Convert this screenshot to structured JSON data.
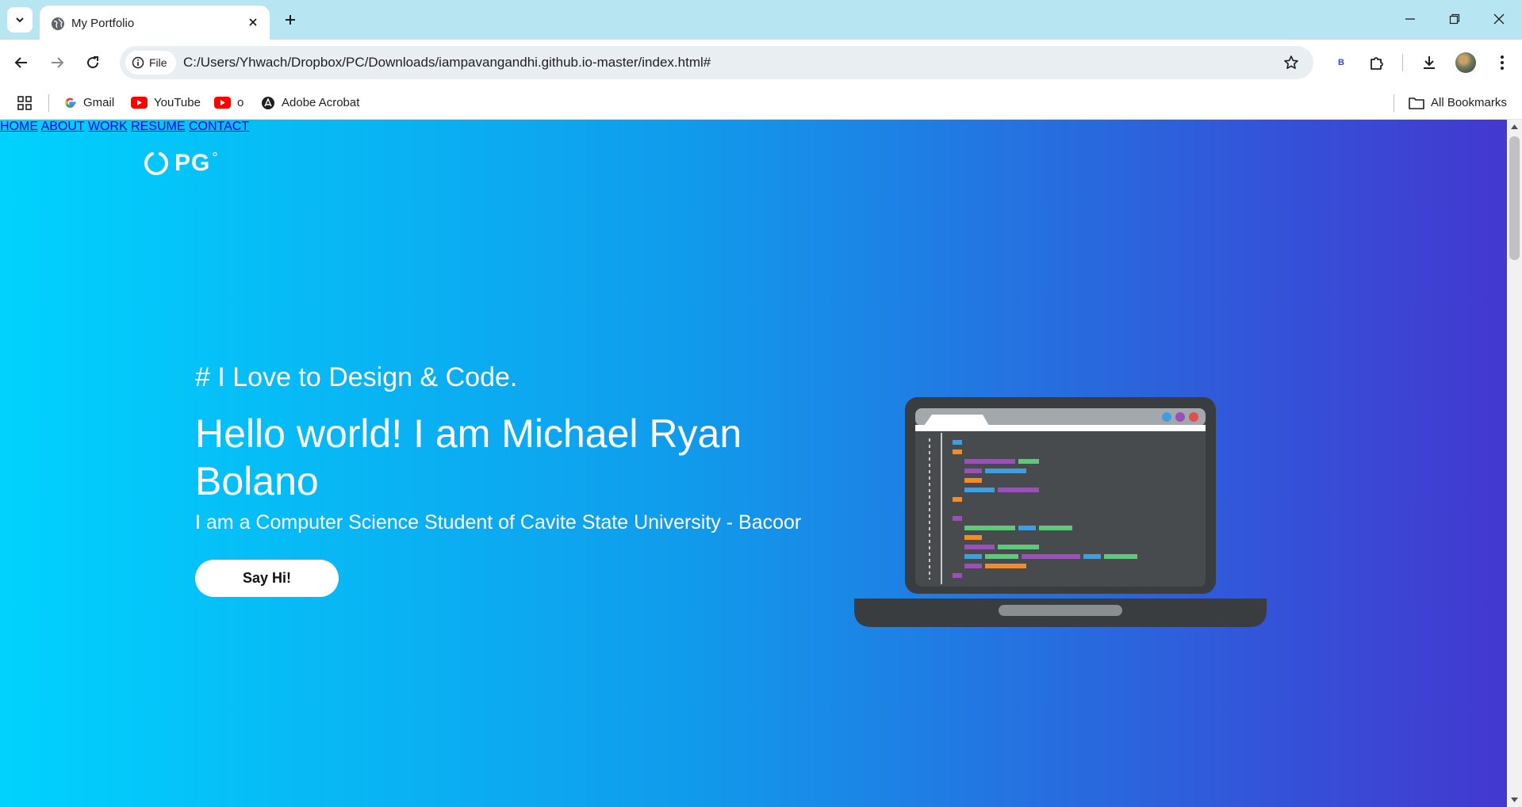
{
  "browser": {
    "tab": {
      "title": "My Portfolio",
      "favicon": "globe-icon"
    },
    "omnibox": {
      "scheme_label": "File",
      "url": "C:/Users/Yhwach/Dropbox/PC/Downloads/iampavangandhi.github.io-master/index.html#"
    },
    "extension_label": "B",
    "bookmarks": [
      {
        "label": "Gmail",
        "icon": "google-icon"
      },
      {
        "label": "YouTube",
        "icon": "youtube-icon"
      },
      {
        "label": "o",
        "icon": "youtube-icon"
      },
      {
        "label": "Adobe Acrobat",
        "icon": "acrobat-icon"
      }
    ],
    "all_bookmarks_label": "All Bookmarks"
  },
  "page": {
    "logo": {
      "text": "PG",
      "mark": "°"
    },
    "nav": [
      "HOME",
      "ABOUT",
      "WORK",
      "RESUME",
      "CONTACT"
    ],
    "hero": {
      "subtitle": "# I Love to Design & Code.",
      "title": "Hello world! I am Michael Ryan Bolano",
      "description": "I am a Computer Science Student of Cavite State University - Bacoor",
      "cta": "Say Hi!"
    }
  },
  "colors": {
    "gradient_start": "#00d2fd",
    "gradient_end": "#4338d0",
    "tabstrip": "#b8e5f2"
  }
}
